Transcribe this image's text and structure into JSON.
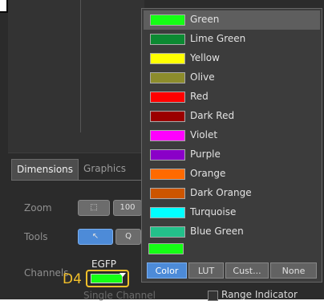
{
  "tabs": {
    "dimensions": "Dimensions",
    "graphics": "Graphics"
  },
  "rows": {
    "zoom": "Zoom",
    "tools": "Tools",
    "channels": "Channels"
  },
  "zoom_buttons": {
    "fit_icon": "fit-icon",
    "zoom100": "100"
  },
  "tools_buttons": {
    "pointer_icon": "arrow-pointer-icon",
    "other_label": "Q"
  },
  "channel": {
    "name": "EGFP",
    "swatch_color": "#15ff15",
    "callout": "D4",
    "single_channel": "Single Channel"
  },
  "range_indicator": "Range Indicator",
  "dropdown": {
    "items": [
      {
        "label": "Green",
        "color": "#15ff15",
        "selected": true
      },
      {
        "label": "Lime Green",
        "color": "#0c8a32"
      },
      {
        "label": "Yellow",
        "color": "#ffff00"
      },
      {
        "label": "Olive",
        "color": "#8c8c2c"
      },
      {
        "label": "Red",
        "color": "#ff0000"
      },
      {
        "label": "Dark Red",
        "color": "#9b0000"
      },
      {
        "label": "Violet",
        "color": "#ff00ff"
      },
      {
        "label": "Purple",
        "color": "#8a00c8"
      },
      {
        "label": "Orange",
        "color": "#ff6a00"
      },
      {
        "label": "Dark Orange",
        "color": "#cc5500"
      },
      {
        "label": "Turquoise",
        "color": "#00ffff"
      },
      {
        "label": "Blue Green",
        "color": "#23c08a"
      }
    ],
    "extra_swatch": "#15ff15",
    "segments": [
      "Color",
      "LUT",
      "Cust...",
      "None"
    ],
    "active_segment": "Color"
  }
}
